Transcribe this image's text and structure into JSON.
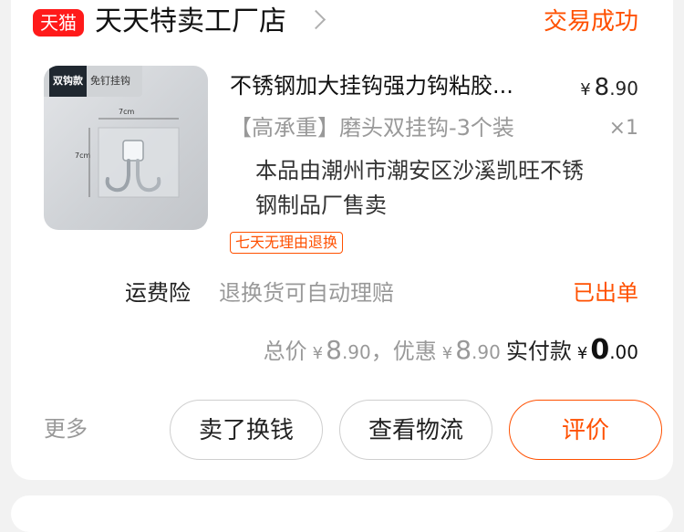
{
  "shop": {
    "logo_text": "天猫",
    "name": "天天特卖工厂店",
    "status": "交易成功"
  },
  "product": {
    "image_tag_main": "双钩款",
    "image_tag_sub": "免钉挂钩",
    "image_dim_width": "7cm",
    "image_dim_height": "7cm",
    "title": "不锈钢加大挂钩强力钩粘胶...",
    "price": {
      "currency": "¥",
      "integer": "8",
      "decimal": ".90"
    },
    "spec": "【高承重】磨头双挂钩-3个装",
    "quantity": "×1",
    "seller_note": "本品由潮州市潮安区沙溪凯旺不锈钢制品厂售卖",
    "return_badge": "七天无理由退换"
  },
  "insurance": {
    "label": "运费险",
    "description": "退换货可自动理赔",
    "status": "已出单"
  },
  "totals": {
    "total_label": "总价",
    "total": {
      "currency": "¥",
      "integer": "8",
      "decimal": ".90"
    },
    "separator": "，",
    "discount_label": "优惠",
    "discount": {
      "currency": "¥",
      "integer": "8",
      "decimal": ".90"
    },
    "paid_label": "实付款",
    "paid": {
      "currency": "¥",
      "integer": "0",
      "decimal": ".00"
    }
  },
  "actions": {
    "more": "更多",
    "sell_label": "卖了换钱",
    "logistics_label": "查看物流",
    "review_label": "评价"
  },
  "colors": {
    "accent": "#ff5000",
    "tmall_red": "#ff1a1a"
  }
}
